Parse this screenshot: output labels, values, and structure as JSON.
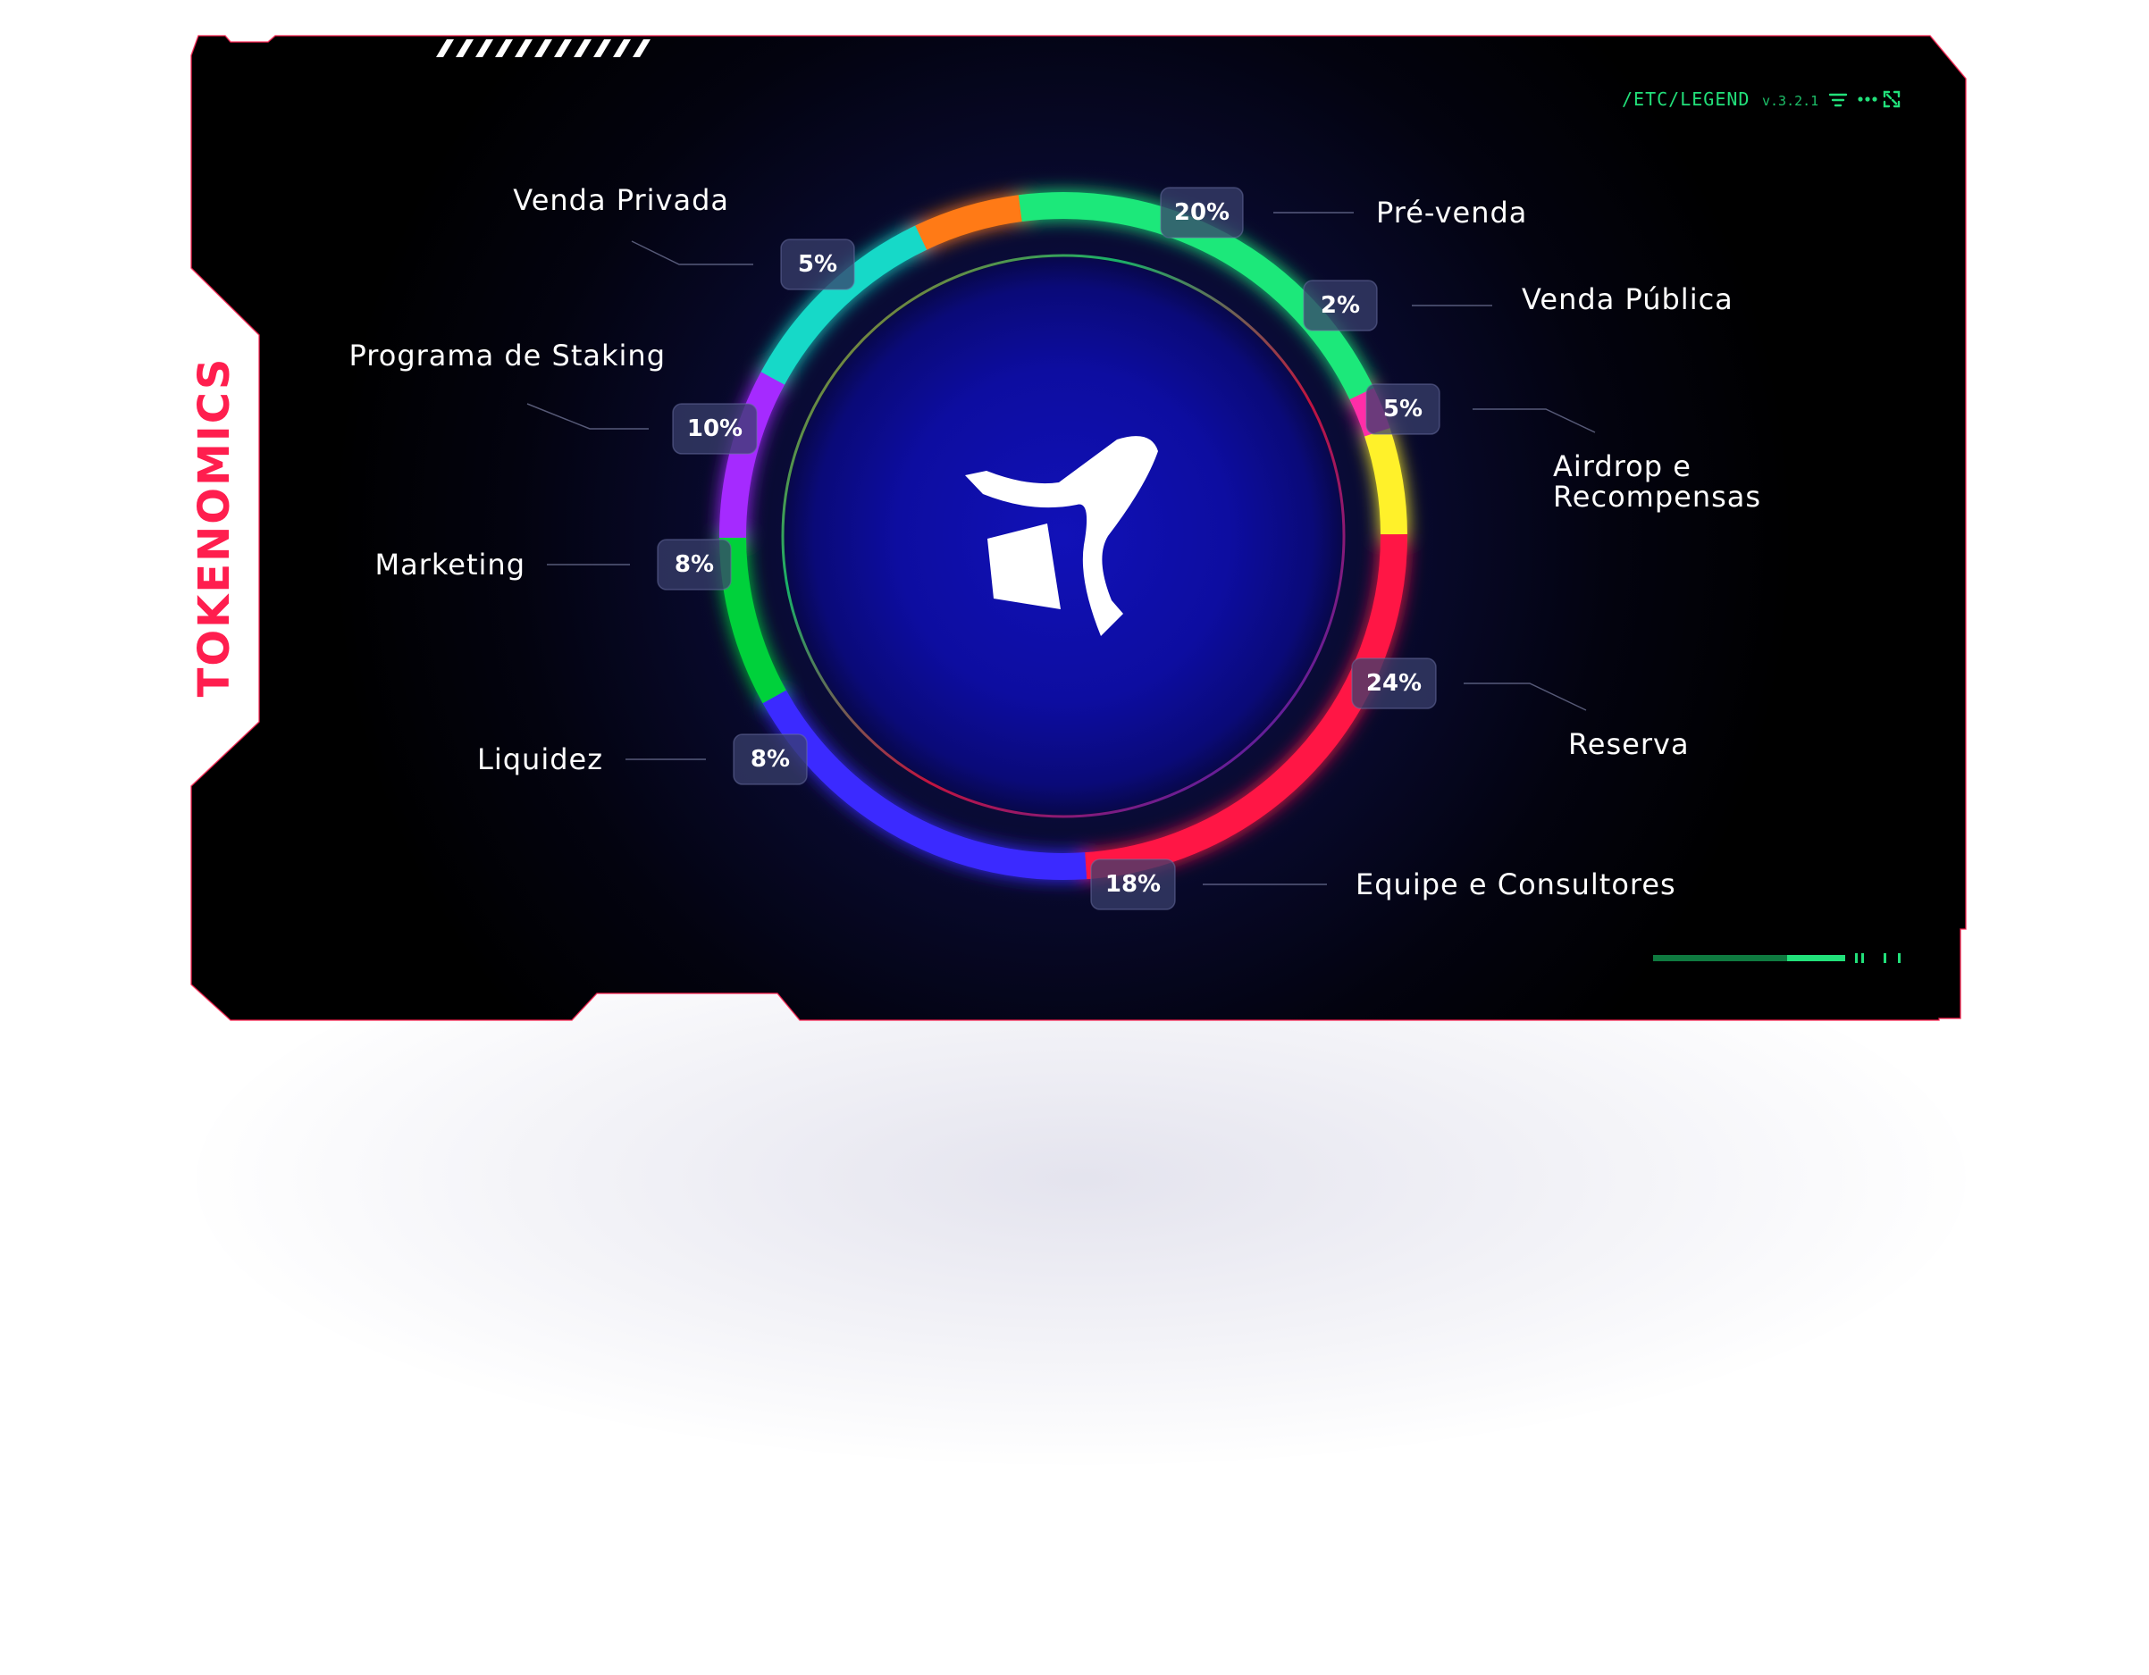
{
  "panel": {
    "side_title": "TOKENOMICS",
    "path_label": "/ETC/LEGEND",
    "version": "v.3.2.1",
    "accent_green": "#22e07a",
    "accent_red": "#ff1e4e"
  },
  "toolbar": {
    "icons": [
      "filter-icon",
      "more-icon",
      "expand-icon"
    ]
  },
  "chart_data": {
    "type": "pie",
    "donut": true,
    "categories": [
      "Pré-venda",
      "Venda Pública",
      "Airdrop e Recompensas",
      "Reserva",
      "Equipe e Consultores",
      "Liquidez",
      "Marketing",
      "Programa de Staking",
      "Venda Privada"
    ],
    "values": [
      20,
      2,
      5,
      24,
      18,
      8,
      8,
      10,
      5
    ],
    "value_labels": [
      "20%",
      "2%",
      "5%",
      "24%",
      "18%",
      "8%",
      "8%",
      "10%",
      "5%"
    ],
    "colors": [
      "#1ee87a",
      "#ff2fa8",
      "#fff12a",
      "#ff1744",
      "#3b2bff",
      "#00d13b",
      "#a52bff",
      "#12d9c8",
      "#ff7a12"
    ],
    "center_icon": "brand-logo-icon"
  }
}
